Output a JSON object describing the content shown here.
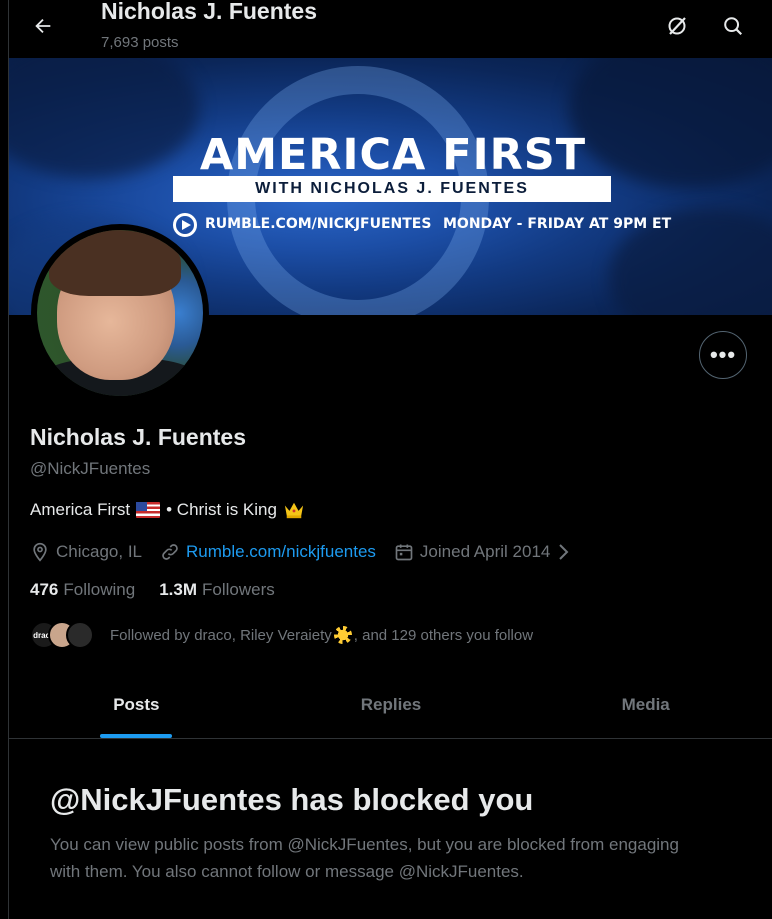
{
  "header": {
    "title": "Nicholas J. Fuentes",
    "post_count": "7,693 posts"
  },
  "banner": {
    "title": "AMERICA FIRST",
    "subtitle": "WITH NICHOLAS J. FUENTES",
    "url": "RUMBLE.COM/NICKJFUENTES",
    "schedule": "MONDAY - FRIDAY AT 9PM ET"
  },
  "profile": {
    "name": "Nicholas J. Fuentes",
    "handle": "@NickJFuentes",
    "bio_text_1": "America First",
    "bio_text_2": "• Christ is King",
    "location": "Chicago, IL",
    "website": "Rumble.com/nickjfuentes",
    "joined": "Joined April 2014",
    "following_count": "476",
    "following_label": "Following",
    "followers_count": "1.3M",
    "followers_label": "Followers",
    "followed_by_1": "Followed by draco, Riley Veraiety",
    "followed_by_2": ", and 129 others you follow",
    "mini_avatar_label": "draco"
  },
  "tabs": [
    {
      "label": "Posts",
      "active": true
    },
    {
      "label": "Replies",
      "active": false
    },
    {
      "label": "Media",
      "active": false
    }
  ],
  "blocked": {
    "title": "@NickJFuentes has blocked you",
    "body": "You can view public posts from @NickJFuentes, but you are blocked from engaging with them. You also cannot follow or message @NickJFuentes."
  },
  "colors": {
    "accent": "#1d9bf0",
    "background": "#000000",
    "secondary_text": "#71767b",
    "primary_text": "#e7e9ea"
  }
}
